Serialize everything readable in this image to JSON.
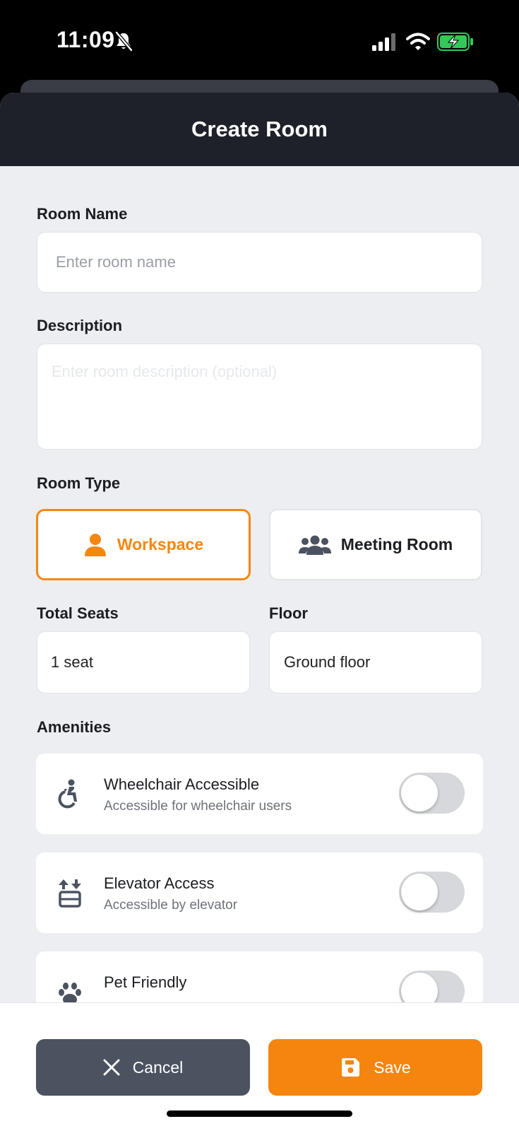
{
  "status_bar": {
    "time": "11:09",
    "icons": [
      "bell-slash-icon",
      "cellular-signal-icon",
      "wifi-icon",
      "battery-charging-icon"
    ]
  },
  "modal": {
    "title": "Create Room"
  },
  "form": {
    "room_name": {
      "label": "Room Name",
      "placeholder": "Enter room name",
      "value": ""
    },
    "description": {
      "label": "Description",
      "placeholder": "Enter room description (optional)",
      "value": ""
    },
    "room_type": {
      "label": "Room Type",
      "options": [
        {
          "label": "Workspace",
          "icon": "person-icon",
          "selected": true
        },
        {
          "label": "Meeting Room",
          "icon": "people-group-icon",
          "selected": false
        }
      ]
    },
    "total_seats": {
      "label": "Total Seats",
      "value": "1 seat"
    },
    "floor": {
      "label": "Floor",
      "value": "Ground floor"
    },
    "amenities": {
      "label": "Amenities",
      "items": [
        {
          "title": "Wheelchair Accessible",
          "subtitle": "Accessible for wheelchair users",
          "icon": "wheelchair-icon",
          "enabled": false
        },
        {
          "title": "Elevator Access",
          "subtitle": "Accessible by elevator",
          "icon": "elevator-icon",
          "enabled": false
        },
        {
          "title": "Pet Friendly",
          "subtitle": "",
          "icon": "paw-icon",
          "enabled": false
        }
      ]
    }
  },
  "footer": {
    "cancel_label": "Cancel",
    "save_label": "Save"
  },
  "colors": {
    "accent": "#F5850E",
    "header_bg": "#1E2129",
    "cancel_bg": "#4B5260",
    "page_bg": "#ECEEF1"
  }
}
